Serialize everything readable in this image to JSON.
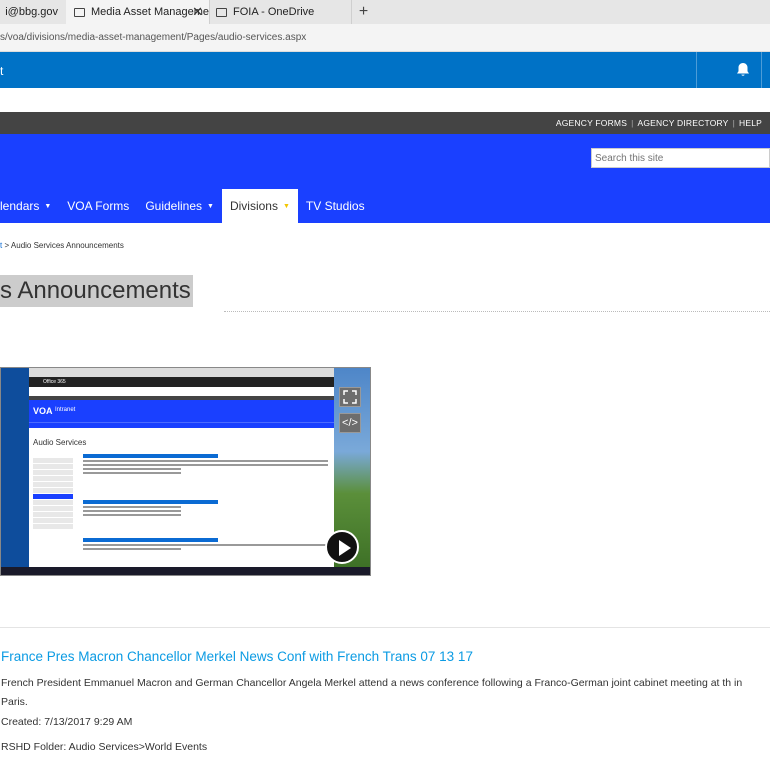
{
  "browser": {
    "tabs": [
      {
        "label": "i@bbg.gov"
      },
      {
        "label": "Media Asset Manageme",
        "close": "✕"
      },
      {
        "label": "FOIA - OneDrive"
      }
    ],
    "new_tab": "+",
    "url": "s/voa/divisions/media-asset-management/Pages/audio-services.aspx"
  },
  "o365": {
    "left_stub": "t",
    "bell_icon": "bell-icon"
  },
  "utility": {
    "links": [
      "AGENCY FORMS",
      "AGENCY DIRECTORY",
      "HELP"
    ],
    "separator": "|"
  },
  "header": {
    "search_placeholder": "Search this site",
    "nav": [
      {
        "label": "lendars",
        "caret": "▼"
      },
      {
        "label": "VOA Forms"
      },
      {
        "label": "Guidelines",
        "caret": "▼"
      },
      {
        "label": "Divisions",
        "caret": "▼",
        "active": true
      },
      {
        "label": "TV Studios"
      }
    ]
  },
  "breadcrumb": {
    "link": "t",
    "rest": " > Audio Services Announcements"
  },
  "page": {
    "title": "s Announcements"
  },
  "video": {
    "inner_o365": "Office 365",
    "inner_logo": "VOA",
    "inner_logo_text": "Intranet",
    "inner_heading": "Audio Services",
    "fullscreen_icon": "expand-icon",
    "embed_label": "</>",
    "play_icon": "play-icon"
  },
  "item": {
    "title": "France Pres Macron Chancellor Merkel News Conf with French Trans 07 13 17",
    "description": "French President Emmanuel Macron and German Chancellor Angela Merkel attend a news conference following a Franco-German joint cabinet meeting at th in Paris.",
    "created": "Created: 7/13/2017 9:29 AM",
    "folder": "RSHD Folder: Audio Services>World Events"
  },
  "colors": {
    "o365_blue": "#0072c6",
    "site_blue": "#1a40ff",
    "link_blue": "#0b9be3",
    "util_dark": "#444444"
  }
}
